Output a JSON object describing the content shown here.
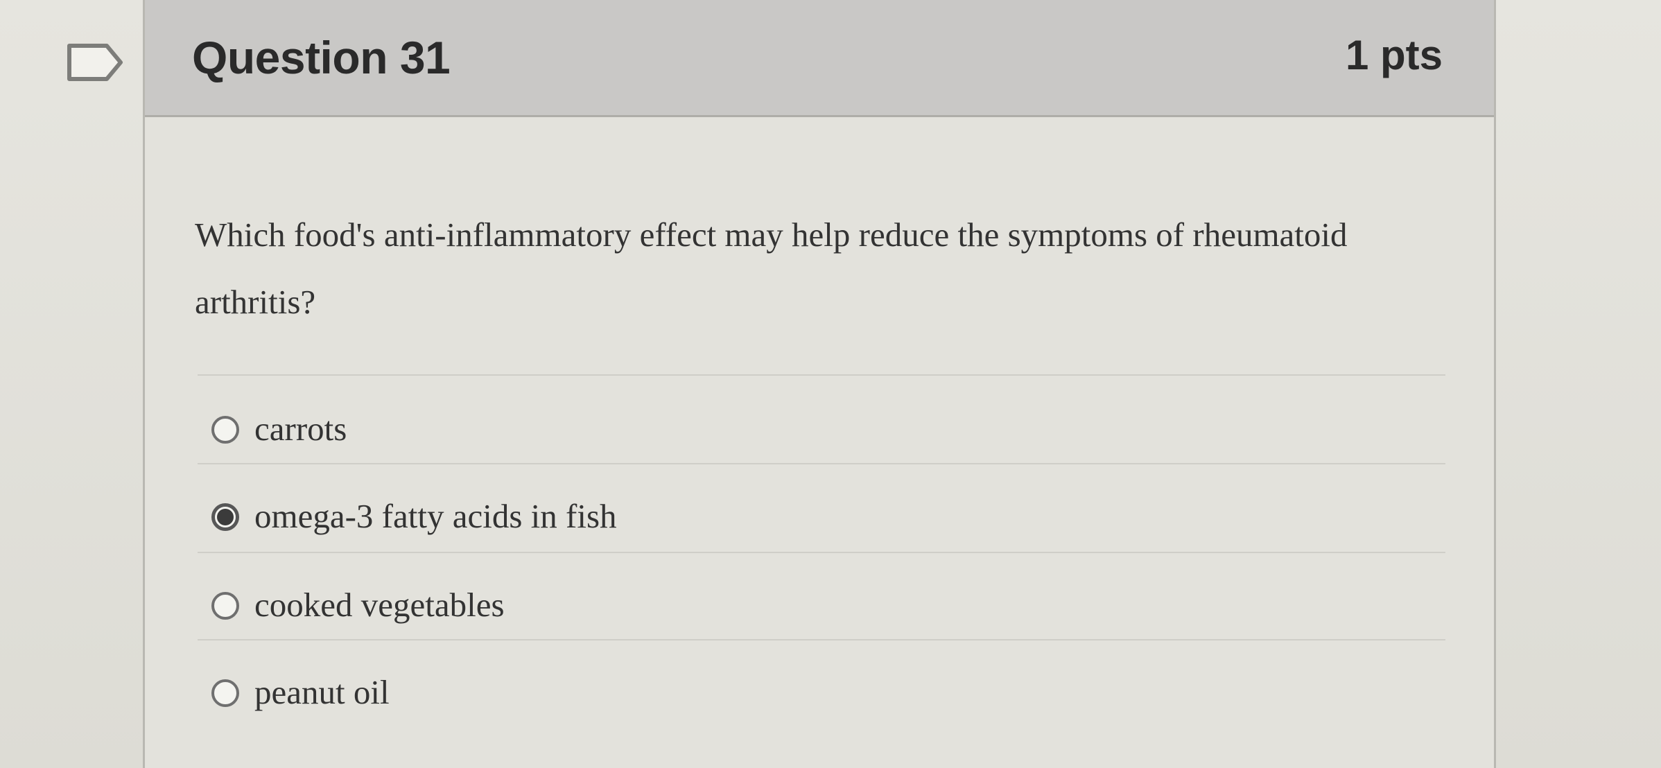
{
  "question": {
    "title": "Question 31",
    "points": "1 pts",
    "text": "Which food's anti-inflammatory effect may help reduce the symptoms of rheumatoid arthritis?",
    "answers": [
      {
        "label": "carrots",
        "selected": false
      },
      {
        "label": "omega-3 fatty acids in fish",
        "selected": true
      },
      {
        "label": "cooked vegetables",
        "selected": false
      },
      {
        "label": "peanut oil",
        "selected": false
      }
    ]
  },
  "icons": {
    "flag": "flag-outline-icon"
  },
  "colors": {
    "header_bg": "#c9c8c6",
    "card_bg": "#e3e2dc",
    "text": "#333333"
  }
}
